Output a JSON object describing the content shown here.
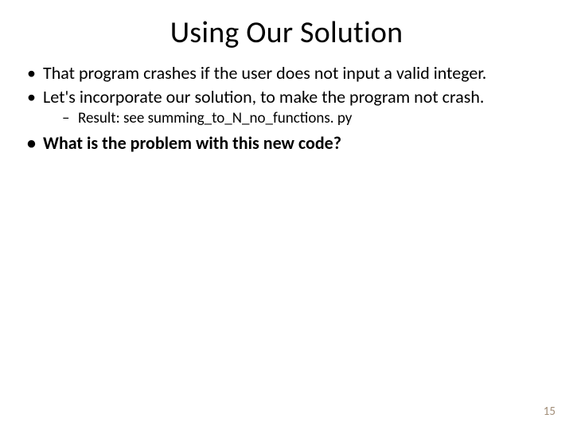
{
  "title": "Using Our Solution",
  "bullets": {
    "b1": "That program crashes if the user does not input a valid integer.",
    "b2": "Let's incorporate our solution, to make the program not crash.",
    "b2_sub": "Result: see summing_to_N_no_functions. py",
    "b3": "What is the problem with this new code?"
  },
  "page_number": "15"
}
